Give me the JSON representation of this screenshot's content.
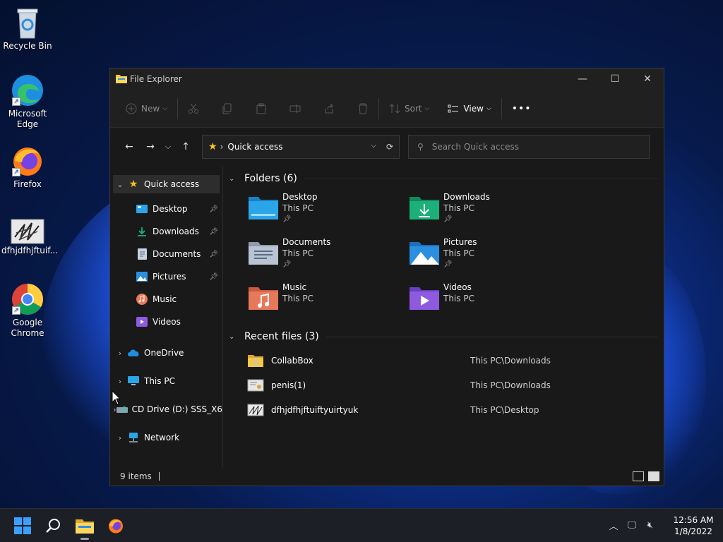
{
  "desktop": {
    "icons": [
      {
        "label": "Recycle Bin",
        "icon": "recycle-bin-icon"
      },
      {
        "label": "Microsoft Edge",
        "icon": "edge-icon"
      },
      {
        "label": "Firefox",
        "icon": "firefox-icon"
      },
      {
        "label": "dfhjdfhjftuif...",
        "icon": "image-thumbnail-icon"
      },
      {
        "label": "Google Chrome",
        "icon": "chrome-icon"
      }
    ]
  },
  "window": {
    "title": "File Explorer",
    "commands": {
      "new_label": "New",
      "sort_label": "Sort",
      "view_label": "View",
      "more_label": "•••"
    },
    "address": {
      "current": "Quick access"
    },
    "search": {
      "placeholder": "Search Quick access"
    },
    "sidebar": {
      "quick_access": "Quick access",
      "pinned": [
        {
          "label": "Desktop",
          "pinned": true
        },
        {
          "label": "Downloads",
          "pinned": true
        },
        {
          "label": "Documents",
          "pinned": true
        },
        {
          "label": "Pictures",
          "pinned": true
        },
        {
          "label": "Music",
          "pinned": false
        },
        {
          "label": "Videos",
          "pinned": false
        }
      ],
      "roots": [
        {
          "label": "OneDrive"
        },
        {
          "label": "This PC"
        },
        {
          "label": "CD Drive (D:) SSS_X6"
        },
        {
          "label": "Network"
        }
      ]
    },
    "folders": {
      "heading": "Folders (6)",
      "items": [
        {
          "name": "Desktop",
          "location": "This PC",
          "pinned": true,
          "color": "#2aa6e8"
        },
        {
          "name": "Downloads",
          "location": "This PC",
          "pinned": true,
          "color": "#1bb07a"
        },
        {
          "name": "Documents",
          "location": "This PC",
          "pinned": true,
          "color": "#b8c4d4"
        },
        {
          "name": "Pictures",
          "location": "This PC",
          "pinned": true,
          "color": "#2b8fe0"
        },
        {
          "name": "Music",
          "location": "This PC",
          "pinned": false,
          "color": "#e8785a"
        },
        {
          "name": "Videos",
          "location": "This PC",
          "pinned": false,
          "color": "#8e5ae0"
        }
      ]
    },
    "recent": {
      "heading": "Recent files (3)",
      "items": [
        {
          "name": "CollabBox",
          "location": "This PC\\Downloads"
        },
        {
          "name": "penis(1)",
          "location": "This PC\\Downloads"
        },
        {
          "name": "dfhjdfhjftuiftyuirtyuk",
          "location": "This PC\\Desktop"
        }
      ]
    },
    "status": {
      "items_count": "9 items"
    }
  },
  "taskbar": {
    "clock_time": "12:56 AM",
    "clock_date": "1/8/2022"
  }
}
